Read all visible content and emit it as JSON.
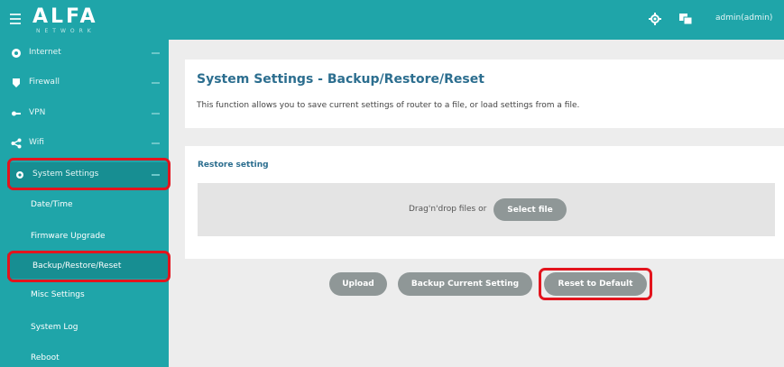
{
  "header": {
    "logo_text": "ALFA",
    "logo_subtext": "NETWORK",
    "user_label": "admin(admin)",
    "icons": [
      "settings-icon",
      "language-icon"
    ]
  },
  "sidebar": {
    "items": [
      {
        "label": "Internet",
        "icon": "globe-icon"
      },
      {
        "label": "Firewall",
        "icon": "shield-icon"
      },
      {
        "label": "VPN",
        "icon": "key-icon"
      },
      {
        "label": "Wifi",
        "icon": "share-icon"
      },
      {
        "label": "System Settings",
        "icon": "gear-icon"
      }
    ],
    "sub_items": [
      {
        "label": "Date/Time"
      },
      {
        "label": "Firmware Upgrade"
      },
      {
        "label": "Backup/Restore/Reset"
      },
      {
        "label": "Misc Settings"
      },
      {
        "label": "System Log"
      },
      {
        "label": "Reboot"
      }
    ]
  },
  "main": {
    "title": "System Settings - Backup/Restore/Reset",
    "description": "This function allows you to save current settings of router to a file, or load settings from a file.",
    "section_label": "Restore setting",
    "drop_text": "Drag'n'drop files or",
    "select_file_label": "Select file",
    "buttons": {
      "upload": "Upload",
      "backup": "Backup Current Setting",
      "reset": "Reset to Default"
    }
  },
  "colors": {
    "brand": "#1fa5a9",
    "highlight": "#e3141d",
    "button": "#8f9797",
    "title": "#2c6e8f"
  }
}
